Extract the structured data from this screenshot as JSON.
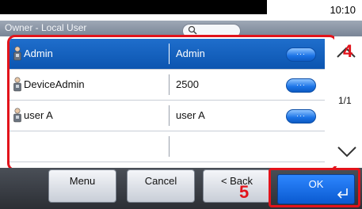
{
  "status_bar": {
    "time": "10:10"
  },
  "owner_bar": {
    "label": "Owner - Local User"
  },
  "icons": {
    "search": "search-icon",
    "user": "user-icon",
    "detail": "more-dots-icon",
    "scroll_up": "chevron-up-icon",
    "scroll_down": "chevron-down-icon",
    "enter": "enter-arrow-icon"
  },
  "list": {
    "rows": [
      {
        "name": "Admin",
        "value": "Admin",
        "selected": true
      },
      {
        "name": "DeviceAdmin",
        "value": "2500",
        "selected": false
      },
      {
        "name": "user A",
        "value": "user A",
        "selected": false
      }
    ],
    "detail_label": "···"
  },
  "pager": {
    "page": "1/1"
  },
  "bottom_bar": {
    "menu": "Menu",
    "cancel": "Cancel",
    "back": "< Back",
    "ok": "OK"
  },
  "annotations": {
    "marker_4": "4",
    "marker_5": "5"
  },
  "colors": {
    "selected_row": "#0c55b0",
    "annotation_red": "#e2131b",
    "ok_button": "#0a5ad0"
  }
}
